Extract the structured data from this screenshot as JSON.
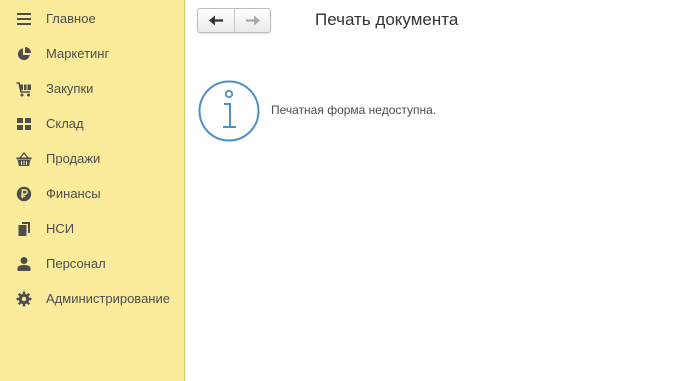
{
  "sidebar": {
    "items": [
      {
        "label": "Главное",
        "icon": "hamburger-menu-icon"
      },
      {
        "label": "Маркетинг",
        "icon": "pie-chart-icon"
      },
      {
        "label": "Закупки",
        "icon": "shopping-cart-icon"
      },
      {
        "label": "Склад",
        "icon": "warehouse-grid-icon"
      },
      {
        "label": "Продажи",
        "icon": "basket-icon"
      },
      {
        "label": "Финансы",
        "icon": "ruble-coin-icon"
      },
      {
        "label": "НСИ",
        "icon": "documents-icon"
      },
      {
        "label": "Персонал",
        "icon": "person-icon"
      },
      {
        "label": "Администрирование",
        "icon": "gear-icon"
      }
    ]
  },
  "header": {
    "title": "Печать документа",
    "back_icon": "arrow-left-icon",
    "forward_icon": "arrow-right-icon"
  },
  "content": {
    "message": "Печатная форма недоступна.",
    "icon": "info-icon"
  },
  "colors": {
    "sidebar_background": "#fbec9c",
    "nav_icon": "#4d4d4d",
    "info_icon": "#4d8fc8",
    "disabled_arrow": "#a8a8a8"
  }
}
